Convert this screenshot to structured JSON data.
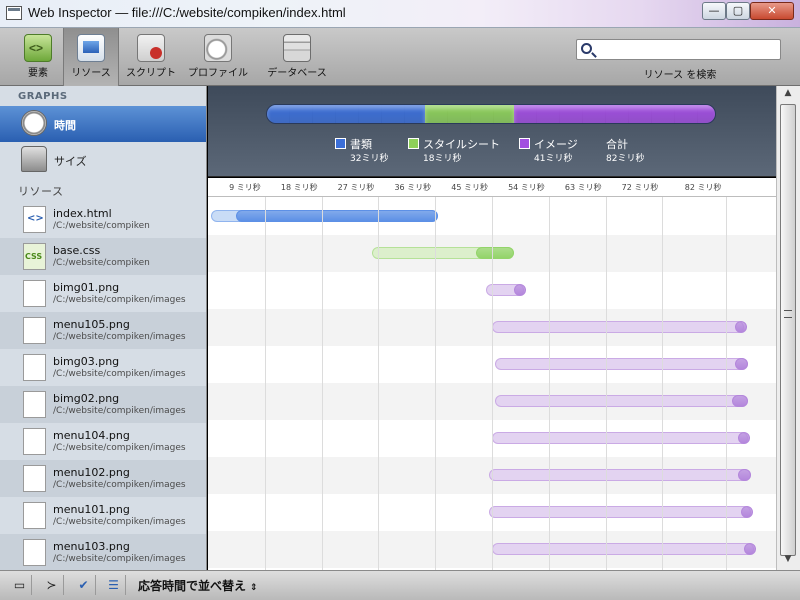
{
  "window": {
    "title": "Web Inspector — file:///C:/website/compiken/index.html",
    "min_label": "—",
    "max_label": "▢",
    "close_label": "✕"
  },
  "toolbar": {
    "buttons": [
      {
        "id": "elements",
        "label": "要素",
        "icon": "elements-icon"
      },
      {
        "id": "resources",
        "label": "リソース",
        "icon": "resources-icon",
        "selected": true
      },
      {
        "id": "scripts",
        "label": "スクリプト",
        "icon": "scripts-icon"
      },
      {
        "id": "profiles",
        "label": "プロファイル",
        "icon": "profiles-icon"
      },
      {
        "id": "databases",
        "label": "データベース",
        "icon": "databases-icon"
      }
    ],
    "search": {
      "value": "",
      "placeholder": "",
      "label": "リソース を検索"
    }
  },
  "sidebar": {
    "graphs_header": "GRAPHS",
    "graphs": [
      {
        "label": "時間",
        "icon": "clock-icon",
        "selected": true
      },
      {
        "label": "サイズ",
        "icon": "weights-icon"
      }
    ],
    "resources_header": "リソース",
    "resources": [
      {
        "name": "index.html",
        "path": "/C:/website/compiken",
        "type": "document"
      },
      {
        "name": "base.css",
        "path": "/C:/website/compiken",
        "type": "stylesheet"
      },
      {
        "name": "bimg01.png",
        "path": "/C:/website/compiken/images",
        "type": "image"
      },
      {
        "name": "menu105.png",
        "path": "/C:/website/compiken/images",
        "type": "image"
      },
      {
        "name": "bimg03.png",
        "path": "/C:/website/compiken/images",
        "type": "image"
      },
      {
        "name": "bimg02.png",
        "path": "/C:/website/compiken/images",
        "type": "image"
      },
      {
        "name": "menu104.png",
        "path": "/C:/website/compiken/images",
        "type": "image"
      },
      {
        "name": "menu102.png",
        "path": "/C:/website/compiken/images",
        "type": "image"
      },
      {
        "name": "menu101.png",
        "path": "/C:/website/compiken/images",
        "type": "image"
      },
      {
        "name": "menu103.png",
        "path": "/C:/website/compiken/images",
        "type": "image"
      }
    ]
  },
  "summary": {
    "categories": [
      {
        "name": "書類",
        "value_label": "32ミリ秒",
        "value": 32,
        "color": "#3c6fd8"
      },
      {
        "name": "スタイルシート",
        "value_label": "18ミリ秒",
        "value": 18,
        "color": "#8ed05a"
      },
      {
        "name": "イメージ",
        "value_label": "41ミリ秒",
        "value": 41,
        "color": "#a24ee0"
      }
    ],
    "total": {
      "name": "合計",
      "value_label": "82ミリ秒"
    }
  },
  "colors": {
    "document": {
      "light": "#c9dcf6",
      "dark": "#5d90e6"
    },
    "stylesheet": {
      "light": "#dcefcc",
      "dark": "#93d46a"
    },
    "image": {
      "light": "#e3d3f1",
      "dark": "#b487dc"
    }
  },
  "chart_data": {
    "type": "bar",
    "title": "",
    "xlabel": "",
    "ylabel": "",
    "xlim": [
      0,
      90
    ],
    "ticks": [
      "9 ミリ秒",
      "18 ミリ秒",
      "27 ミリ秒",
      "36 ミリ秒",
      "45 ミリ秒",
      "54 ミリ秒",
      "63 ミリ秒",
      "72 ミリ秒",
      "82 ミリ秒"
    ],
    "tick_values": [
      9,
      18,
      27,
      36,
      45,
      54,
      63,
      72,
      82
    ],
    "categories": [
      "index.html",
      "base.css",
      "bimg01.png",
      "menu105.png",
      "bimg03.png",
      "bimg02.png",
      "menu104.png",
      "menu102.png",
      "menu101.png",
      "menu103.png"
    ],
    "series": [
      {
        "start": [
          0,
          25.5,
          43.5,
          44.5,
          45,
          45,
          44.5,
          44,
          44,
          44.5
        ]
      },
      {
        "response": [
          4.5,
          42.5,
          48.5,
          83.5,
          83.5,
          83,
          84,
          84,
          84.5,
          85
        ]
      },
      {
        "end": [
          36.5,
          48.5,
          50,
          85,
          85.5,
          85.5,
          85.5,
          86,
          86,
          86.5
        ]
      }
    ]
  },
  "statusbar": {
    "sort_label": "応答時間で並べ替え",
    "sort_arrows": "⇕"
  }
}
